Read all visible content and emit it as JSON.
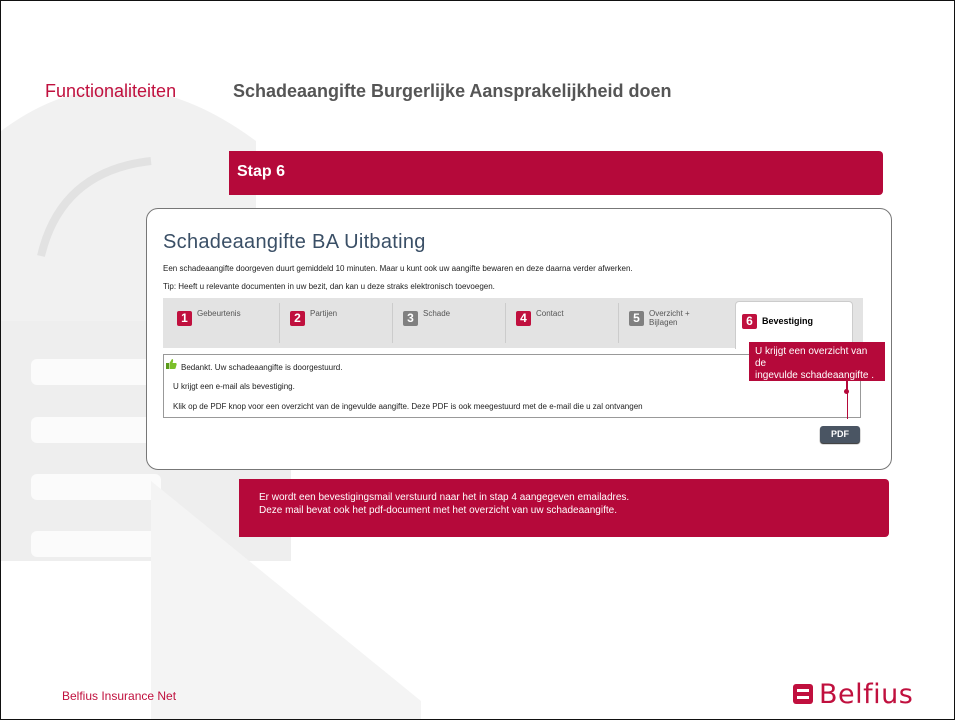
{
  "header": {
    "section_label": "Functionaliteiten",
    "title": "Schadeaangifte Burgerlijke Aansprakelijkheid doen"
  },
  "step_bar": {
    "label": "Stap 6"
  },
  "form": {
    "title": "Schadeaangifte BA Uitbating",
    "intro": "Een schadeaangifte doorgeven duurt gemiddeld 10 minuten. Maar u kunt ook uw aangifte bewaren en deze daarna verder afwerken.",
    "tip": "Tip: Heeft u relevante documenten in uw bezit, dan kan u deze straks elektronisch toevoegen.",
    "tabs": [
      {
        "num": "1",
        "label": "Gebeurtenis",
        "color": "#c0103e"
      },
      {
        "num": "2",
        "label": "Partijen",
        "color": "#c0103e"
      },
      {
        "num": "3",
        "label": "Schade",
        "color": "#808080"
      },
      {
        "num": "4",
        "label": "Contact",
        "color": "#c0103e"
      },
      {
        "num": "5",
        "label": "Overzicht +",
        "label2": "Bijlagen",
        "color": "#808080"
      },
      {
        "num": "6",
        "label": "Bevestiging",
        "color": "#c0103e"
      }
    ],
    "messages": {
      "success": "Bedankt. Uw schadeaangifte is doorgestuurd.",
      "email": "U krijgt een e-mail als bevestiging.",
      "pdf_info": "Klik op de PDF knop voor een overzicht van de ingevulde aangifte. Deze PDF is ook meegestuurd met de e-mail die u zal ontvangen"
    },
    "pdf_button": "PDF"
  },
  "callout": {
    "line1": "U krijgt een overzicht van de",
    "line2": "ingevulde schadeaangifte ."
  },
  "notice": {
    "line1": "Er wordt een bevestigingsmail verstuurd naar het in stap 4 aangegeven emailadres.",
    "line2": "Deze mail bevat ook het pdf-document met het overzicht van uw schadeaangifte."
  },
  "footer": {
    "company": "Belfius Insurance Net",
    "logo_text": "Belfius"
  },
  "colors": {
    "brand": "#c0103e",
    "bar": "#b5093a",
    "title": "#3a4f66"
  }
}
